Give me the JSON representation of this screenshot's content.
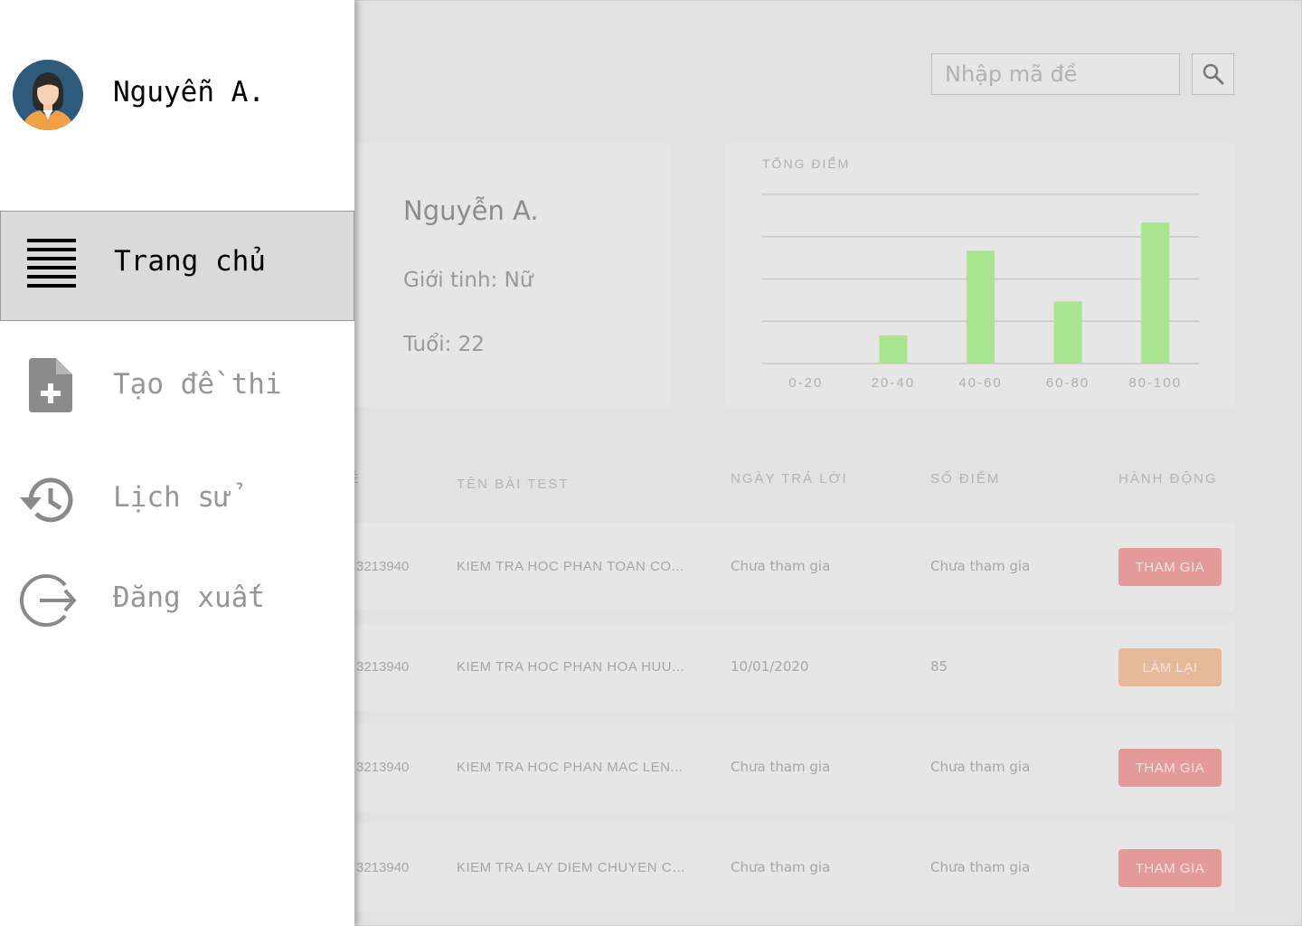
{
  "search": {
    "placeholder": "Nhập mã đề",
    "icon": "search-icon"
  },
  "profile": {
    "name": "Nguyễn A.",
    "gender": "Giới tinh: Nữ",
    "age": "Tuổi: 22"
  },
  "chart_data": {
    "type": "bar",
    "title": "TỔNG ĐIỂM",
    "categories": [
      "0-20",
      "20-40",
      "40-60",
      "60-80",
      "80-100"
    ],
    "values": [
      0,
      1,
      4,
      2.2,
      5
    ],
    "ylim": [
      0,
      6
    ],
    "grid": true,
    "bar_color": "#a9e48e"
  },
  "table": {
    "headers": {
      "id": "É",
      "name": "TÊN BÀI TEST",
      "date": "NGÀY TRẢ LỜI",
      "score": "SỐ ĐIỂM",
      "action": "HÀNH ĐỘNG"
    },
    "rows": [
      {
        "id": "3213940",
        "name": "KIEM TRA HOC PHAN TOAN CO...",
        "date": "Chưa tham gia",
        "score": "Chưa tham gia",
        "action": "THAM GIA",
        "action_color": "#e59a9a"
      },
      {
        "id": "3213940",
        "name": "KIEM TRA HOC PHAN HOA HUU...",
        "date": "10/01/2020",
        "score": "85",
        "action": "LÀM LẠI",
        "action_color": "#e6b999"
      },
      {
        "id": "3213940",
        "name": "KIEM TRA HOC PHAN MAC LEN...",
        "date": "Chưa tham gia",
        "score": "Chưa tham gia",
        "action": "THAM GIA",
        "action_color": "#e59a9a"
      },
      {
        "id": "3213940",
        "name": "KIEM TRA LAY DIEM CHUYEN CA...",
        "date": "Chưa tham gia",
        "score": "Chưa tham gia",
        "action": "THAM GIA",
        "action_color": "#e59a9a"
      }
    ]
  },
  "drawer": {
    "user_name": "Nguyễn A.",
    "avatar_icon": "user-avatar",
    "items": [
      {
        "label": "Trang chủ",
        "icon": "menu-icon",
        "active": true
      },
      {
        "label": "Tạo đề thi",
        "icon": "add-file-icon",
        "active": false
      },
      {
        "label": "Lịch sử",
        "icon": "history-icon",
        "active": false
      },
      {
        "label": "Đăng xuất",
        "icon": "logout-icon",
        "active": false
      }
    ]
  }
}
